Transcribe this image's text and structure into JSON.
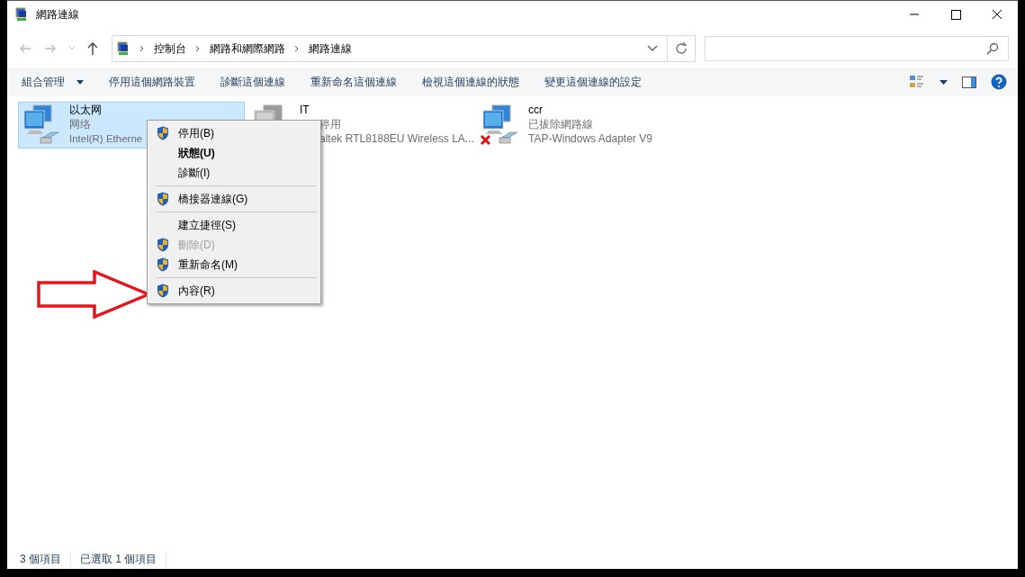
{
  "window": {
    "title": "網路連線"
  },
  "address": {
    "crumbs": [
      "控制台",
      "網路和網際網路",
      "網路連線"
    ]
  },
  "toolbar": {
    "items": [
      {
        "label": "組合管理",
        "dropdown": true
      },
      {
        "label": "停用這個網路裝置",
        "dropdown": false
      },
      {
        "label": "診斷這個連線",
        "dropdown": false
      },
      {
        "label": "重新命名這個連線",
        "dropdown": false
      },
      {
        "label": "檢視這個連線的狀態",
        "dropdown": false
      },
      {
        "label": "變更這個連線的設定",
        "dropdown": false
      }
    ]
  },
  "connections": [
    {
      "name": "以太网",
      "status": "网络",
      "device": "Intel(R) Etherne",
      "selected": true,
      "disabled": false,
      "unplugged": false
    },
    {
      "name": "IT",
      "status": "停用",
      "device": "altek RTL8188EU Wireless LA...",
      "selected": false,
      "disabled": true,
      "unplugged": false
    },
    {
      "name": "ccr",
      "status": "已拔除網路線",
      "device": "TAP-Windows Adapter V9",
      "selected": false,
      "disabled": false,
      "unplugged": true
    }
  ],
  "context_menu": [
    {
      "kind": "item",
      "label": "停用(B)",
      "shield": true,
      "bold": false,
      "disabled": false
    },
    {
      "kind": "item",
      "label": "狀態(U)",
      "shield": false,
      "bold": true,
      "disabled": false
    },
    {
      "kind": "item",
      "label": "診斷(I)",
      "shield": false,
      "bold": false,
      "disabled": false
    },
    {
      "kind": "separator"
    },
    {
      "kind": "item",
      "label": "橋接器連線(G)",
      "shield": true,
      "bold": false,
      "disabled": false
    },
    {
      "kind": "separator"
    },
    {
      "kind": "item",
      "label": "建立捷徑(S)",
      "shield": false,
      "bold": false,
      "disabled": false
    },
    {
      "kind": "item",
      "label": "刪除(D)",
      "shield": true,
      "bold": false,
      "disabled": true
    },
    {
      "kind": "item",
      "label": "重新命名(M)",
      "shield": true,
      "bold": false,
      "disabled": false
    },
    {
      "kind": "separator"
    },
    {
      "kind": "item",
      "label": "內容(R)",
      "shield": true,
      "bold": false,
      "disabled": false
    }
  ],
  "status_bar": [
    "3 個項目",
    "已選取 1 個項目"
  ]
}
